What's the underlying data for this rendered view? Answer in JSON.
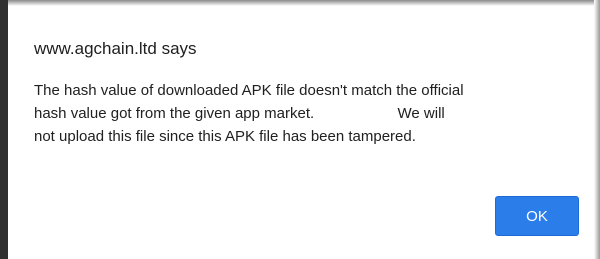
{
  "dialog": {
    "title": "www.agchain.ltd says",
    "message_lines": [
      "The hash value of downloaded APK file doesn't match the official",
      "hash value got from the given app market.                    We will",
      "not upload this file since this APK file has been tampered."
    ],
    "ok_label": "OK"
  },
  "colors": {
    "button_bg": "#2b7de9",
    "button_text": "#ffffff",
    "text": "#202020",
    "background": "#ffffff"
  }
}
